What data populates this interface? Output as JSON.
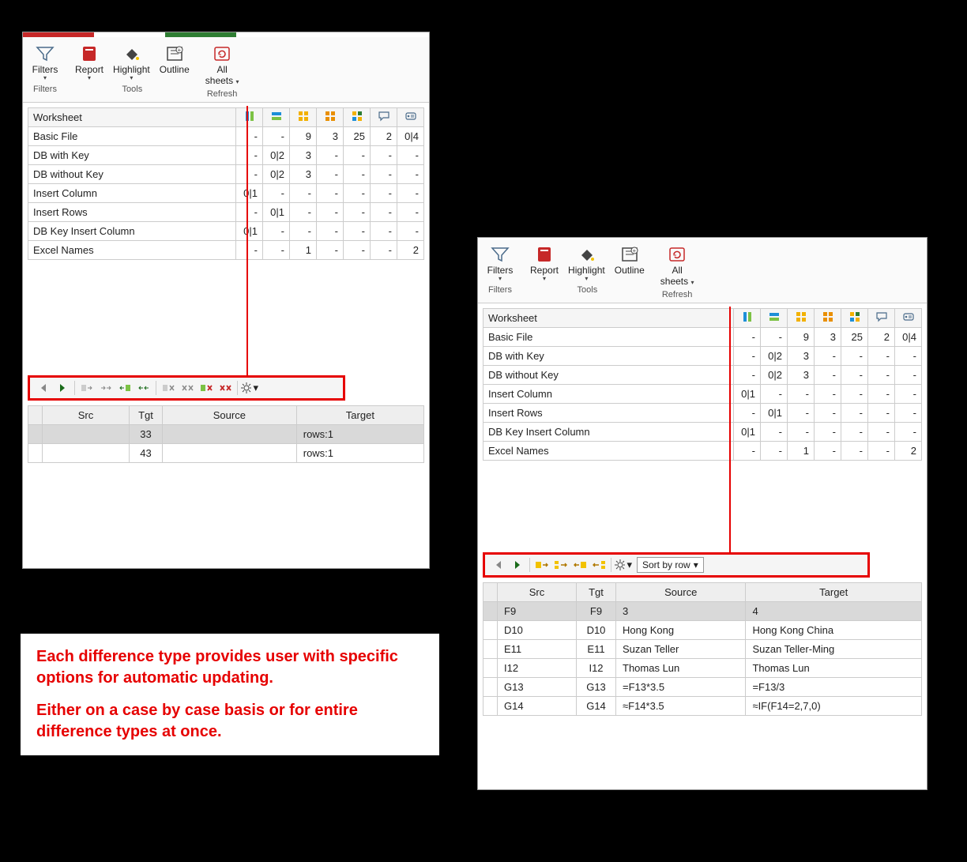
{
  "ribbon": {
    "filters": "Filters",
    "report": "Report",
    "highlight": "Highlight",
    "outline": "Outline",
    "allsheets_l1": "All",
    "allsheets_l2": "sheets",
    "group_filters": "Filters",
    "group_tools": "Tools",
    "group_refresh": "Refresh"
  },
  "ws_header": "Worksheet",
  "rows": [
    {
      "name": "Basic File",
      "c1": "-",
      "c2": "-",
      "c3": "9",
      "c4": "3",
      "c5": "25",
      "c6": "2",
      "c7": "0|4"
    },
    {
      "name": "DB with Key",
      "c1": "-",
      "c2": "0|2",
      "c3": "3",
      "c4": "-",
      "c5": "-",
      "c6": "-",
      "c7": "-"
    },
    {
      "name": "DB without Key",
      "c1": "-",
      "c2": "0|2",
      "c3": "3",
      "c4": "-",
      "c5": "-",
      "c6": "-",
      "c7": "-"
    },
    {
      "name": "Insert Column",
      "c1": "0|1",
      "c2": "-",
      "c3": "-",
      "c4": "-",
      "c5": "-",
      "c6": "-",
      "c7": "-"
    },
    {
      "name": "Insert Rows",
      "c1": "-",
      "c2": "0|1",
      "c3": "-",
      "c4": "-",
      "c5": "-",
      "c6": "-",
      "c7": "-"
    },
    {
      "name": "DB Key Insert Column",
      "c1": "0|1",
      "c2": "-",
      "c3": "-",
      "c4": "-",
      "c5": "-",
      "c6": "-",
      "c7": "-"
    },
    {
      "name": "Excel Names",
      "c1": "-",
      "c2": "-",
      "c3": "1",
      "c4": "-",
      "c5": "-",
      "c6": "-",
      "c7": "2"
    }
  ],
  "detail_left": {
    "cols": {
      "src": "Src",
      "tgt": "Tgt",
      "source": "Source",
      "target": "Target"
    },
    "rows": [
      {
        "src": "",
        "tgt": "33",
        "source": "",
        "target": "rows:1",
        "sel": true
      },
      {
        "src": "",
        "tgt": "43",
        "source": "",
        "target": "rows:1",
        "sel": false
      }
    ]
  },
  "detail_right": {
    "cols": {
      "src": "Src",
      "tgt": "Tgt",
      "source": "Source",
      "target": "Target"
    },
    "sort_label": "Sort by row",
    "rows": [
      {
        "src": "F9",
        "tgt": "F9",
        "source": "3",
        "target": "4",
        "sel": true
      },
      {
        "src": "D10",
        "tgt": "D10",
        "source": "Hong Kong",
        "target": "Hong Kong China"
      },
      {
        "src": "E11",
        "tgt": "E11",
        "source": "Suzan Teller",
        "target": "Suzan Teller-Ming"
      },
      {
        "src": "I12",
        "tgt": "I12",
        "source": "Thomas Lun",
        "target": "Thomas Lun"
      },
      {
        "src": "G13",
        "tgt": "G13",
        "source": "=F13*3.5",
        "target": "=F13/3"
      },
      {
        "src": "G14",
        "tgt": "G14",
        "source": "≈F14*3.5",
        "target": "≈IF(F14=2,7,0)"
      }
    ]
  },
  "note": {
    "p1": "Each difference type provides user with specific options for automatic updating.",
    "p2": "Either on a case by case basis or for entire difference types at once."
  }
}
